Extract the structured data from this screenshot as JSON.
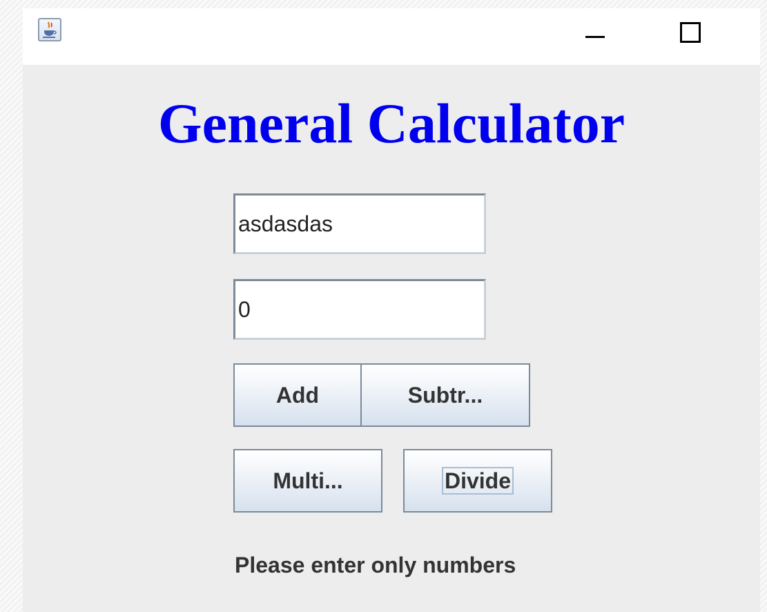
{
  "window": {
    "app_icon": "java-coffee-cup-icon",
    "minimize_icon": "minimize-icon",
    "maximize_icon": "maximize-icon"
  },
  "main": {
    "title": "General Calculator",
    "title_color": "#0000ee",
    "first_number": {
      "value": "asdasdas"
    },
    "second_number": {
      "value": "0"
    },
    "buttons": {
      "add": "Add",
      "subtract": "Subtr...",
      "multiply": "Multi...",
      "divide": "Divide"
    },
    "message": "Please enter only numbers"
  }
}
